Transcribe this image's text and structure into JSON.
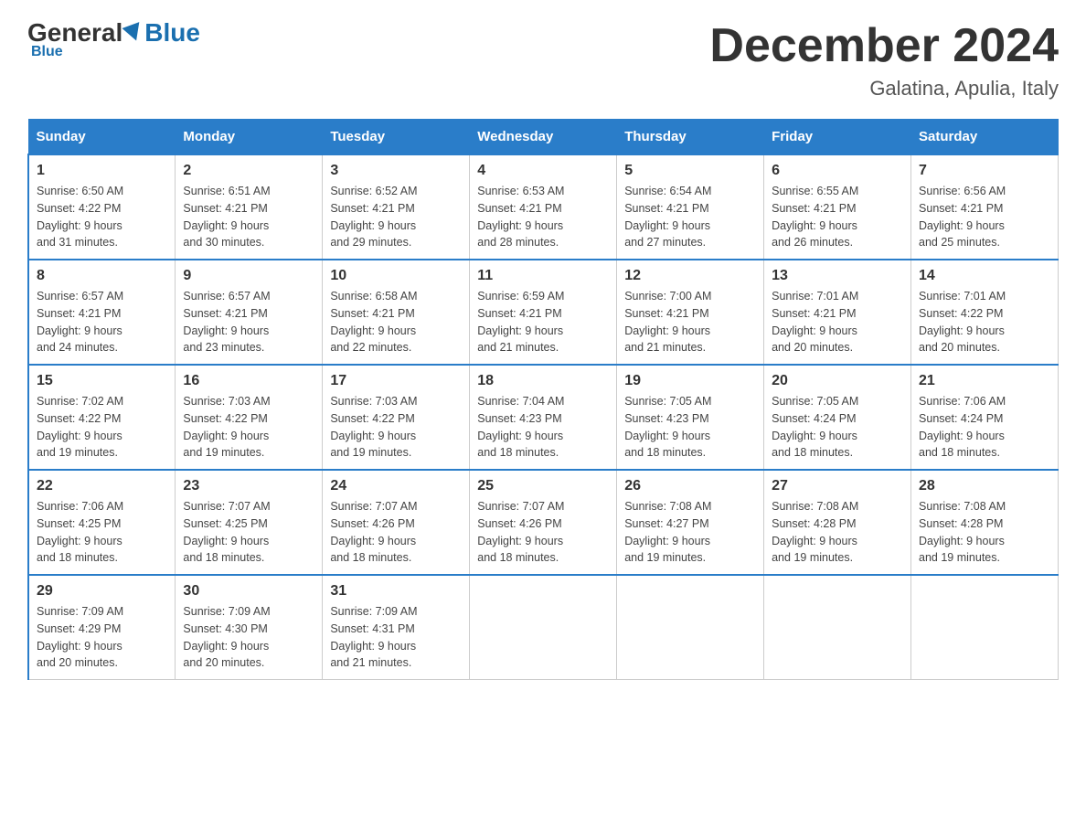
{
  "header": {
    "logo_general": "General",
    "logo_blue": "Blue",
    "title": "December 2024",
    "subtitle": "Galatina, Apulia, Italy"
  },
  "days_of_week": [
    "Sunday",
    "Monday",
    "Tuesday",
    "Wednesday",
    "Thursday",
    "Friday",
    "Saturday"
  ],
  "weeks": [
    [
      {
        "day": "1",
        "sunrise": "6:50 AM",
        "sunset": "4:22 PM",
        "daylight": "9 hours and 31 minutes."
      },
      {
        "day": "2",
        "sunrise": "6:51 AM",
        "sunset": "4:21 PM",
        "daylight": "9 hours and 30 minutes."
      },
      {
        "day": "3",
        "sunrise": "6:52 AM",
        "sunset": "4:21 PM",
        "daylight": "9 hours and 29 minutes."
      },
      {
        "day": "4",
        "sunrise": "6:53 AM",
        "sunset": "4:21 PM",
        "daylight": "9 hours and 28 minutes."
      },
      {
        "day": "5",
        "sunrise": "6:54 AM",
        "sunset": "4:21 PM",
        "daylight": "9 hours and 27 minutes."
      },
      {
        "day": "6",
        "sunrise": "6:55 AM",
        "sunset": "4:21 PM",
        "daylight": "9 hours and 26 minutes."
      },
      {
        "day": "7",
        "sunrise": "6:56 AM",
        "sunset": "4:21 PM",
        "daylight": "9 hours and 25 minutes."
      }
    ],
    [
      {
        "day": "8",
        "sunrise": "6:57 AM",
        "sunset": "4:21 PM",
        "daylight": "9 hours and 24 minutes."
      },
      {
        "day": "9",
        "sunrise": "6:57 AM",
        "sunset": "4:21 PM",
        "daylight": "9 hours and 23 minutes."
      },
      {
        "day": "10",
        "sunrise": "6:58 AM",
        "sunset": "4:21 PM",
        "daylight": "9 hours and 22 minutes."
      },
      {
        "day": "11",
        "sunrise": "6:59 AM",
        "sunset": "4:21 PM",
        "daylight": "9 hours and 21 minutes."
      },
      {
        "day": "12",
        "sunrise": "7:00 AM",
        "sunset": "4:21 PM",
        "daylight": "9 hours and 21 minutes."
      },
      {
        "day": "13",
        "sunrise": "7:01 AM",
        "sunset": "4:21 PM",
        "daylight": "9 hours and 20 minutes."
      },
      {
        "day": "14",
        "sunrise": "7:01 AM",
        "sunset": "4:22 PM",
        "daylight": "9 hours and 20 minutes."
      }
    ],
    [
      {
        "day": "15",
        "sunrise": "7:02 AM",
        "sunset": "4:22 PM",
        "daylight": "9 hours and 19 minutes."
      },
      {
        "day": "16",
        "sunrise": "7:03 AM",
        "sunset": "4:22 PM",
        "daylight": "9 hours and 19 minutes."
      },
      {
        "day": "17",
        "sunrise": "7:03 AM",
        "sunset": "4:22 PM",
        "daylight": "9 hours and 19 minutes."
      },
      {
        "day": "18",
        "sunrise": "7:04 AM",
        "sunset": "4:23 PM",
        "daylight": "9 hours and 18 minutes."
      },
      {
        "day": "19",
        "sunrise": "7:05 AM",
        "sunset": "4:23 PM",
        "daylight": "9 hours and 18 minutes."
      },
      {
        "day": "20",
        "sunrise": "7:05 AM",
        "sunset": "4:24 PM",
        "daylight": "9 hours and 18 minutes."
      },
      {
        "day": "21",
        "sunrise": "7:06 AM",
        "sunset": "4:24 PM",
        "daylight": "9 hours and 18 minutes."
      }
    ],
    [
      {
        "day": "22",
        "sunrise": "7:06 AM",
        "sunset": "4:25 PM",
        "daylight": "9 hours and 18 minutes."
      },
      {
        "day": "23",
        "sunrise": "7:07 AM",
        "sunset": "4:25 PM",
        "daylight": "9 hours and 18 minutes."
      },
      {
        "day": "24",
        "sunrise": "7:07 AM",
        "sunset": "4:26 PM",
        "daylight": "9 hours and 18 minutes."
      },
      {
        "day": "25",
        "sunrise": "7:07 AM",
        "sunset": "4:26 PM",
        "daylight": "9 hours and 18 minutes."
      },
      {
        "day": "26",
        "sunrise": "7:08 AM",
        "sunset": "4:27 PM",
        "daylight": "9 hours and 19 minutes."
      },
      {
        "day": "27",
        "sunrise": "7:08 AM",
        "sunset": "4:28 PM",
        "daylight": "9 hours and 19 minutes."
      },
      {
        "day": "28",
        "sunrise": "7:08 AM",
        "sunset": "4:28 PM",
        "daylight": "9 hours and 19 minutes."
      }
    ],
    [
      {
        "day": "29",
        "sunrise": "7:09 AM",
        "sunset": "4:29 PM",
        "daylight": "9 hours and 20 minutes."
      },
      {
        "day": "30",
        "sunrise": "7:09 AM",
        "sunset": "4:30 PM",
        "daylight": "9 hours and 20 minutes."
      },
      {
        "day": "31",
        "sunrise": "7:09 AM",
        "sunset": "4:31 PM",
        "daylight": "9 hours and 21 minutes."
      },
      null,
      null,
      null,
      null
    ]
  ]
}
